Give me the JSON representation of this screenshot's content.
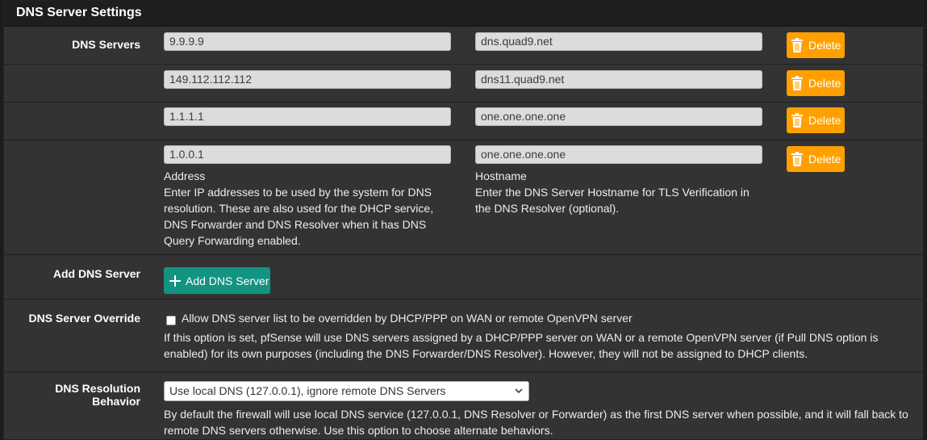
{
  "panel": {
    "title": "DNS Server Settings"
  },
  "dns_servers": {
    "label": "DNS Servers",
    "rows": [
      {
        "address": "9.9.9.9",
        "hostname": "dns.quad9.net",
        "delete_label": "Delete"
      },
      {
        "address": "149.112.112.112",
        "hostname": "dns11.quad9.net",
        "delete_label": "Delete"
      },
      {
        "address": "1.1.1.1",
        "hostname": "one.one.one.one",
        "delete_label": "Delete"
      },
      {
        "address": "1.0.0.1",
        "hostname": "one.one.one.one",
        "delete_label": "Delete"
      }
    ],
    "address_title": "Address",
    "address_help_lines": [
      "Enter IP addresses to be used by the system for DNS",
      "resolution. These are also used for the DHCP service,",
      "DNS Forwarder and DNS Resolver when it has DNS",
      "Query Forwarding enabled."
    ],
    "hostname_title": "Hostname",
    "hostname_help_lines": [
      "Enter the DNS Server Hostname for TLS Verification in",
      "the DNS Resolver (optional)."
    ]
  },
  "add_dns": {
    "label": "Add DNS Server",
    "button_label": "Add DNS Server"
  },
  "override": {
    "label": "DNS Server Override",
    "checked": false,
    "checkbox_label": "Allow DNS server list to be overridden by DHCP/PPP on WAN or remote OpenVPN server",
    "help_lines": [
      "If this option is set, pfSense will use DNS servers assigned by a DHCP/PPP server on WAN or a remote OpenVPN server (if Pull DNS option is",
      "enabled) for its own purposes (including the DNS Forwarder/DNS Resolver). However, they will not be assigned to DHCP clients."
    ]
  },
  "resolution": {
    "label": "DNS Resolution Behavior",
    "selected": "Use local DNS (127.0.0.1), ignore remote DNS Servers",
    "help_lines": [
      "By default the firewall will use local DNS service (127.0.0.1, DNS Resolver or Forwarder) as the first DNS server when possible, and it will fall back to",
      "remote DNS servers otherwise. Use this option to choose alternate behaviors."
    ]
  },
  "colors": {
    "panel_bg": "#333333",
    "heading_bg": "#1e1e1e",
    "delete_button": "#ffa000",
    "add_button": "#139382"
  },
  "icons": {
    "delete": "trash-icon",
    "add": "plus-icon",
    "select": "chevron-down-icon"
  }
}
